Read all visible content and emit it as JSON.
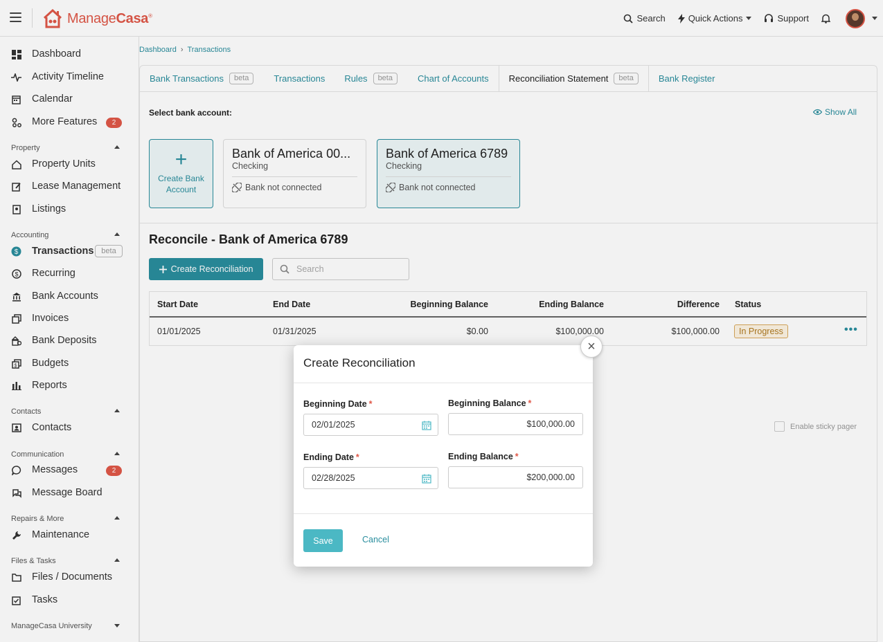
{
  "app": {
    "brand_prefix": "Manage",
    "brand_suffix": "Casa",
    "brand_mark": "®"
  },
  "topbar": {
    "search_label": "Search",
    "quick_actions_label": "Quick Actions",
    "support_label": "Support"
  },
  "sidebar": {
    "top_items": [
      {
        "label": "Dashboard",
        "icon": "dashboard-icon"
      },
      {
        "label": "Activity Timeline",
        "icon": "activity-icon"
      },
      {
        "label": "Calendar",
        "icon": "calendar-icon"
      },
      {
        "label": "More Features",
        "icon": "features-icon",
        "badge": "2"
      }
    ],
    "sections": [
      {
        "title": "Property",
        "items": [
          "Property Units",
          "Lease Management",
          "Listings"
        ]
      },
      {
        "title": "Accounting",
        "items": [
          "Transactions",
          "Recurring",
          "Bank Accounts",
          "Invoices",
          "Bank Deposits",
          "Budgets",
          "Reports"
        ],
        "transactions_beta": "beta"
      },
      {
        "title": "Contacts",
        "items": [
          "Contacts"
        ]
      },
      {
        "title": "Communication",
        "items": [
          "Messages",
          "Message Board"
        ],
        "messages_badge": "2"
      },
      {
        "title": "Repairs & More",
        "items": [
          "Maintenance"
        ]
      },
      {
        "title": "Files & Tasks",
        "items": [
          "Files / Documents",
          "Tasks"
        ]
      },
      {
        "title": "ManageCasa University",
        "items": []
      }
    ]
  },
  "breadcrumb": {
    "items": [
      "Dashboard",
      "Transactions"
    ]
  },
  "tabs": [
    {
      "label": "Bank Transactions",
      "beta": "beta"
    },
    {
      "label": "Transactions"
    },
    {
      "label": "Rules",
      "beta": "beta"
    },
    {
      "label": "Chart of Accounts"
    },
    {
      "label": "Reconciliation Statement",
      "beta": "beta",
      "active": true
    },
    {
      "label": "Bank Register"
    }
  ],
  "accounts": {
    "select_label": "Select bank account:",
    "show_all": "Show All",
    "create_label": "Create Bank Account",
    "create_plus": "+",
    "cards": [
      {
        "name": "Bank of America 00...",
        "type": "Checking",
        "status": "Bank not connected"
      },
      {
        "name": "Bank of America 6789",
        "type": "Checking",
        "status": "Bank not connected",
        "selected": true
      }
    ]
  },
  "reconcile": {
    "title": "Reconcile - Bank of America 6789",
    "create_button": "Create Reconciliation",
    "search_placeholder": "Search",
    "columns": [
      "Start Date",
      "End Date",
      "Beginning Balance",
      "Ending Balance",
      "Difference",
      "Status"
    ],
    "rows": [
      {
        "start": "01/01/2025",
        "end": "01/31/2025",
        "beginning": "$0.00",
        "ending": "$100,000.00",
        "difference": "$100,000.00",
        "status": "In Progress"
      }
    ],
    "sticky_pager": "Enable sticky pager"
  },
  "modal": {
    "title": "Create Reconciliation",
    "close": "×",
    "beginning_date_label": "Beginning Date",
    "beginning_date_value": "02/01/2025",
    "beginning_balance_label": "Beginning Balance",
    "beginning_balance_value": "$100,000.00",
    "ending_date_label": "Ending Date",
    "ending_date_value": "02/28/2025",
    "ending_balance_label": "Ending Balance",
    "ending_balance_value": "$200,000.00",
    "required_mark": "*",
    "save_label": "Save",
    "cancel_label": "Cancel"
  },
  "colors": {
    "brand": "#e05848",
    "accent": "#2a8e9e",
    "save": "#4bb8c4"
  }
}
